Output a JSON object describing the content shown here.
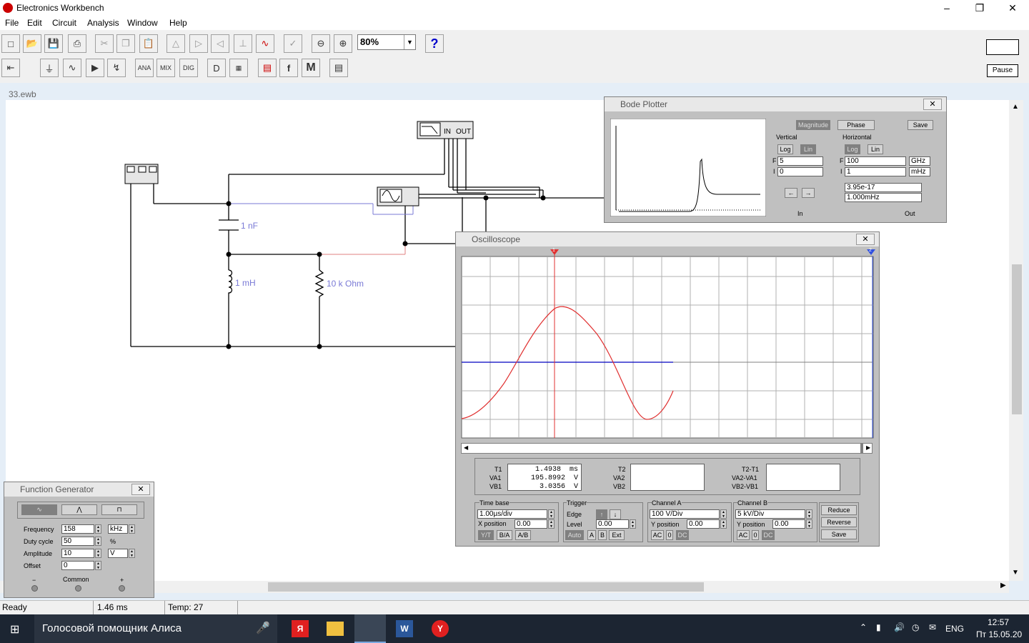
{
  "app": {
    "title": "Electronics Workbench"
  },
  "menu": [
    "File",
    "Edit",
    "Circuit",
    "Analysis",
    "Window",
    "Help"
  ],
  "toolbar": {
    "zoom": "80%",
    "pause_label": "Pause",
    "help_glyph": "?"
  },
  "document": {
    "tab": "33.ewb"
  },
  "circuit": {
    "capacitor_label": "1 nF",
    "inductor_label": "1 mH",
    "resistor_label": "10 k Ohm",
    "bode_in": "IN",
    "bode_out": "OUT"
  },
  "bode": {
    "title": "Bode Plotter",
    "magnitude_label": "Magnitude",
    "phase_label": "Phase",
    "save_label": "Save",
    "vertical_label": "Vertical",
    "horizontal_label": "Horizontal",
    "log_label": "Log",
    "lin_label": "Lin",
    "f_label": "F",
    "i_label": "I",
    "v_final": "5",
    "v_initial": "0",
    "h_final": "100",
    "h_final_unit": "GHz",
    "h_initial": "1",
    "h_initial_unit": "mHz",
    "readout_value": "3.95e-17",
    "readout_freq": "1.000mHz",
    "in_label": "In",
    "out_label": "Out"
  },
  "osc": {
    "title": "Oscilloscope",
    "t1_label": "T1",
    "va1_label": "VA1",
    "vb1_label": "VB1",
    "t2_label": "T2",
    "va2_label": "VA2",
    "vb2_label": "VB2",
    "dt_label": "T2-T1",
    "dva_label": "VA2-VA1",
    "dvb_label": "VB2-VB1",
    "t1_value": "1.4938  ms",
    "va1_value": "195.8992  V",
    "vb1_value": "3.0356  V",
    "timebase_label": "Time base",
    "timebase": "1.00µs/div",
    "xpos_label": "X position",
    "xpos": "0.00",
    "yt_label": "Y/T",
    "ba_label": "B/A",
    "ab_label": "A/B",
    "trigger_label": "Trigger",
    "edge_label": "Edge",
    "level_label": "Level",
    "level": "0.00",
    "auto_label": "Auto",
    "a_label": "A",
    "b_label": "B",
    "ext_label": "Ext",
    "cha_label": "Channel A",
    "cha_scale": "100  V/Div",
    "cha_ypos": "0.00",
    "chb_label": "Channel B",
    "chb_scale": "5 kV/Div",
    "chb_ypos": "0.00",
    "ypos_label": "Y position",
    "ac_label": "AC",
    "zero_label": "0",
    "dc_label": "DC",
    "reduce_label": "Reduce",
    "reverse_label": "Reverse",
    "save_label": "Save",
    "cursor1_marker": "1",
    "cursor2_marker": "2"
  },
  "fg": {
    "title": "Function Generator",
    "frequency_label": "Frequency",
    "frequency": "158",
    "frequency_unit": "kHz",
    "duty_label": "Duty cycle",
    "duty": "50",
    "duty_unit": "%",
    "amplitude_label": "Amplitude",
    "amplitude": "10",
    "amplitude_unit": "V",
    "offset_label": "Offset",
    "offset": "0",
    "minus": "−",
    "common": "Common",
    "plus": "+"
  },
  "status": {
    "ready": "Ready",
    "time": "1.46 ms",
    "temp": "Temp:  27"
  },
  "taskbar": {
    "search": "Голосовой помощник Алиса",
    "lang": "ENG",
    "time": "12:57",
    "date": "Пт 15.05.20"
  }
}
